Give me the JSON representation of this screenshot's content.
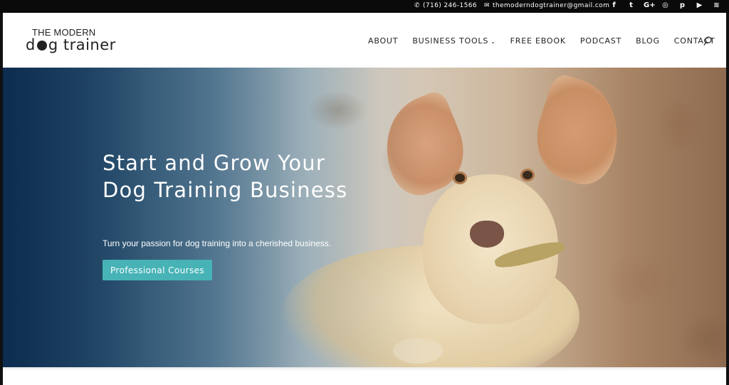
{
  "topbar": {
    "phone": "(716) 246-1566",
    "email": "themoderndogtrainer@gmail.com",
    "social": [
      {
        "icon": "facebook-icon",
        "glyph": "f"
      },
      {
        "icon": "twitter-icon",
        "glyph": "t"
      },
      {
        "icon": "google-plus-icon",
        "glyph": "G+"
      },
      {
        "icon": "instagram-icon",
        "glyph": "◎"
      },
      {
        "icon": "pinterest-icon",
        "glyph": "p"
      },
      {
        "icon": "youtube-icon",
        "glyph": "▶"
      },
      {
        "icon": "rss-icon",
        "glyph": "≋"
      }
    ]
  },
  "header": {
    "logo_top": "THE MODERN",
    "logo_word1": "d",
    "logo_word2": "g trainer",
    "nav": {
      "about": "ABOUT",
      "business_tools": "BUSINESS TOOLS",
      "free_ebook": "FREE EBOOK",
      "podcast": "PODCAST",
      "blog": "BLOG",
      "contact": "CONTACT"
    }
  },
  "hero": {
    "title": "Start and Grow Your Dog Training Business",
    "subtitle": "Turn your passion for dog training into a cherished business.",
    "cta_label": "Professional Courses"
  },
  "colors": {
    "cta": "#47b3b6",
    "topbar": "#0a0a0a",
    "hero_overlay": "#0c2c50"
  }
}
